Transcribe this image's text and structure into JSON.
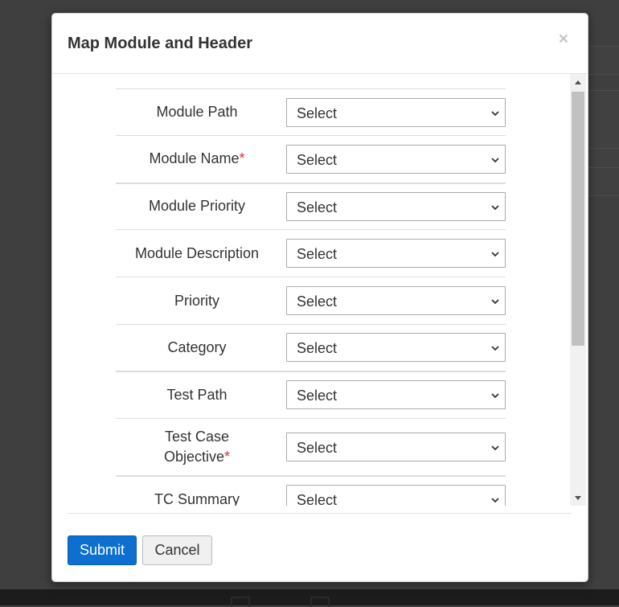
{
  "modal": {
    "title": "Map Module and Header",
    "close_glyph": "×"
  },
  "rows": [
    {
      "label": "Module Path",
      "required": false,
      "select_value": "Select"
    },
    {
      "label": "Module Name",
      "required": true,
      "select_value": "Select"
    },
    {
      "label": "Module Priority",
      "required": false,
      "select_value": "Select"
    },
    {
      "label": "Module Description",
      "required": false,
      "select_value": "Select"
    },
    {
      "label": "Priority",
      "required": false,
      "select_value": "Select"
    },
    {
      "label": "Category",
      "required": false,
      "select_value": "Select"
    },
    {
      "label": "Test Path",
      "required": false,
      "select_value": "Select"
    },
    {
      "label": "Test Case Objective",
      "required": true,
      "select_value": "Select"
    },
    {
      "label": "TC Summary",
      "required": false,
      "select_value": "Select"
    }
  ],
  "required_marker": "*",
  "footer": {
    "submit_label": "Submit",
    "cancel_label": "Cancel"
  },
  "colors": {
    "primary_button": "#0d6fd0",
    "required_marker": "#d9322f"
  },
  "icons": {
    "select_caret": "chevron-down-icon",
    "close": "close-icon"
  }
}
